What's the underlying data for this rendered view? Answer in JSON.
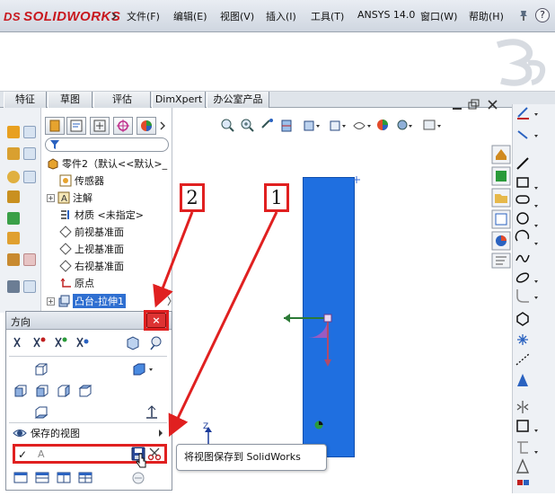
{
  "app": {
    "logo_text": "SOLIDWORKS",
    "logo_mark": "DS"
  },
  "menu": {
    "items": [
      "文件(F)",
      "编辑(E)",
      "视图(V)",
      "插入(I)",
      "工具(T)",
      "ANSYS 14.0",
      "窗口(W)",
      "帮助(H)"
    ],
    "help_glyph": "?"
  },
  "tabs": [
    "特征",
    "草图",
    "评估",
    "DimXpert",
    "办公室产品"
  ],
  "feature_tree": {
    "root": "零件2（默认<<默认>_",
    "items": [
      {
        "label": "传感器",
        "expandable": false
      },
      {
        "label": "注解",
        "expandable": true
      },
      {
        "label": "材质 <未指定>",
        "expandable": false
      },
      {
        "label": "前视基准面",
        "expandable": false
      },
      {
        "label": "上视基准面",
        "expandable": false
      },
      {
        "label": "右视基准面",
        "expandable": false
      },
      {
        "label": "原点",
        "expandable": false
      },
      {
        "label": "凸台-拉伸1",
        "expandable": true,
        "selected": true
      }
    ],
    "expand_glyph": "+"
  },
  "orientation_dialog": {
    "title": "方向",
    "close_glyph": "×",
    "saved_views_label": "保存的视图",
    "saved_view_value": "A",
    "check_glyph": "✓"
  },
  "tooltip": {
    "text": "将视图保存到 SolidWorks"
  },
  "callouts": {
    "one": "1",
    "two": "2"
  },
  "axis": {
    "z_label": "Z"
  },
  "colors": {
    "part_blue": "#1f6fe0",
    "highlight_red": "#e02020",
    "selection_blue": "#2f6fd1"
  }
}
